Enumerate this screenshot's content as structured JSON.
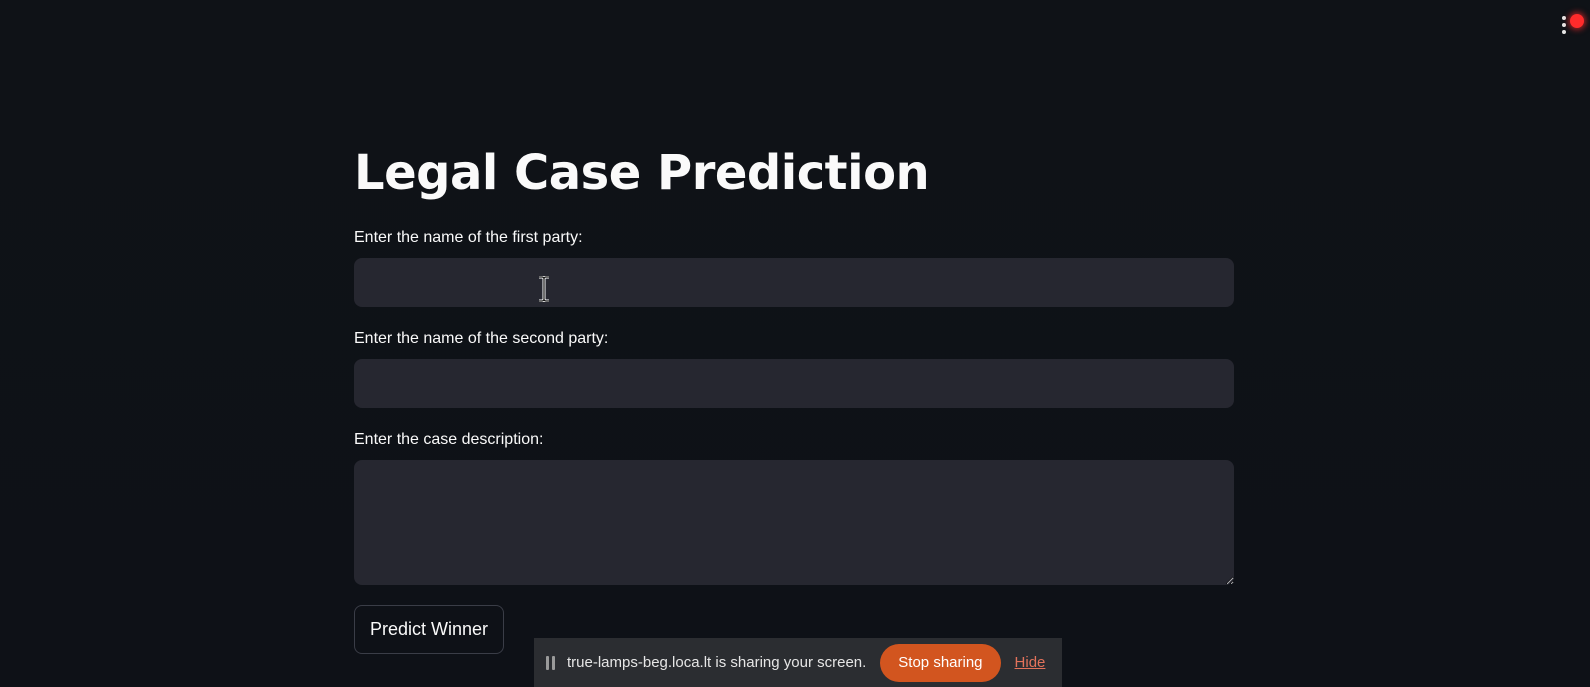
{
  "app": {
    "title": "Legal Case Prediction"
  },
  "form": {
    "first_party_label": "Enter the name of the first party:",
    "first_party_value": "",
    "second_party_label": "Enter the name of the second party:",
    "second_party_value": "",
    "description_label": "Enter the case description:",
    "description_value": "",
    "submit_label": "Predict Winner"
  },
  "share_bar": {
    "message": "true-lamps-beg.loca.lt is sharing your screen.",
    "stop_label": "Stop sharing",
    "hide_label": "Hide"
  },
  "icons": {
    "main_menu": "more-vertical-icon",
    "recording": "recording-indicator-icon",
    "grip": "drag-grip-icon",
    "cursor": "text-cursor-icon"
  },
  "colors": {
    "background": "#0e1117",
    "input_background": "#262730",
    "stop_button": "#d2551f",
    "hide_link": "#e2725b",
    "recording": "#ff2b2b"
  }
}
